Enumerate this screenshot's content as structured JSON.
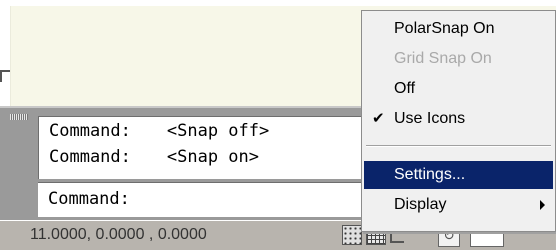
{
  "command_window": {
    "history": [
      {
        "prompt": "Command:",
        "message": "<Snap off>"
      },
      {
        "prompt": "Command:",
        "message": "<Snap on>"
      }
    ],
    "input_prompt": "Command:"
  },
  "status_bar": {
    "coordinates": "11.0000, 0.0000 , 0.0000",
    "icons": [
      "snap-icon",
      "grid-icon",
      "ortho-icon",
      "polar-icon",
      "blank-button"
    ]
  },
  "context_menu": {
    "items": [
      {
        "label": "PolarSnap On",
        "enabled": true,
        "checked": false
      },
      {
        "label": "Grid Snap On",
        "enabled": false,
        "checked": false
      },
      {
        "label": "Off",
        "enabled": true,
        "checked": false
      },
      {
        "label": "Use Icons",
        "enabled": true,
        "checked": true
      },
      {
        "label": "Settings...",
        "enabled": true,
        "checked": false,
        "selected": true
      },
      {
        "label": "Display",
        "enabled": true,
        "checked": false,
        "has_submenu": true
      }
    ],
    "check_glyph": "✔",
    "colors": {
      "selection_bg": "#0a246a",
      "selection_text": "#ffffff",
      "disabled_text": "#a9a9a9"
    }
  },
  "colors": {
    "drawing_background": "#f7f7e8",
    "panel_gray": "#9a9a9a",
    "status_bar": "#b8b4ae"
  }
}
